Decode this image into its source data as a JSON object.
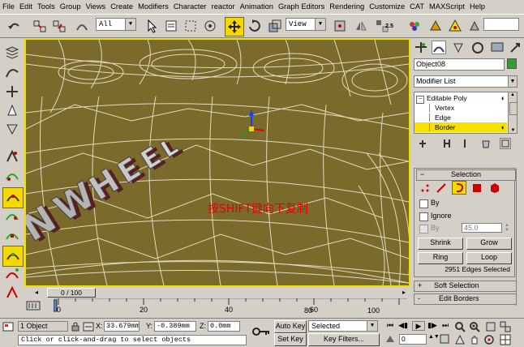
{
  "menu": [
    "File",
    "Edit",
    "Tools",
    "Group",
    "Views",
    "Create",
    "Modifiers",
    "Character",
    "reactor",
    "Animation",
    "Graph Editors",
    "Rendering",
    "Customize",
    "CAT",
    "MAXScript",
    "Help"
  ],
  "toolbar": {
    "selection_filter": "All",
    "reference_coord": "View",
    "snap_label": "2.5"
  },
  "viewport": {
    "annotation": "按SHIFT键向下复制",
    "model_text": "NWHEEL"
  },
  "command_panel": {
    "object_name": "Object08",
    "object_color": "#2ea02e",
    "modifier_list": "Modifier List",
    "stack": [
      "Editable Poly",
      "Vertex",
      "Edge",
      "Border"
    ],
    "selected_stack_item": "Border"
  },
  "selection_rollout": {
    "title": "Selection",
    "by_label": "By",
    "ignore_label": "Ignore",
    "by_angle_label": "By",
    "angle_value": "45.0",
    "shrink": "Shrink",
    "grow": "Grow",
    "ring": "Ring",
    "loop": "Loop",
    "status": "2951 Edges Selected"
  },
  "rollouts": [
    {
      "sign": "+",
      "title": "Soft Selection"
    },
    {
      "sign": "-",
      "title": "Edit Borders"
    }
  ],
  "timeline": {
    "frame_label": "0 / 100",
    "ticks": [
      "0",
      "20",
      "40",
      "60",
      "80",
      "100"
    ]
  },
  "status": {
    "selected_count": "1 Object",
    "x_label": "X:",
    "x_value": "33.679mm",
    "y_label": "Y:",
    "y_value": "-0.389mm",
    "z_label": "Z:",
    "z_value": "0.0mm",
    "auto_key": "Auto Key",
    "set_key": "Set Key",
    "key_mode": "Selected",
    "key_filters": "Key Filters...",
    "frame_value": "0",
    "prompt": "Click or click-and-drag to select objects"
  },
  "colors": {
    "viewport_bg": "#7a6a2c",
    "highlight": "#f5d800",
    "annotation": "#e80000"
  }
}
